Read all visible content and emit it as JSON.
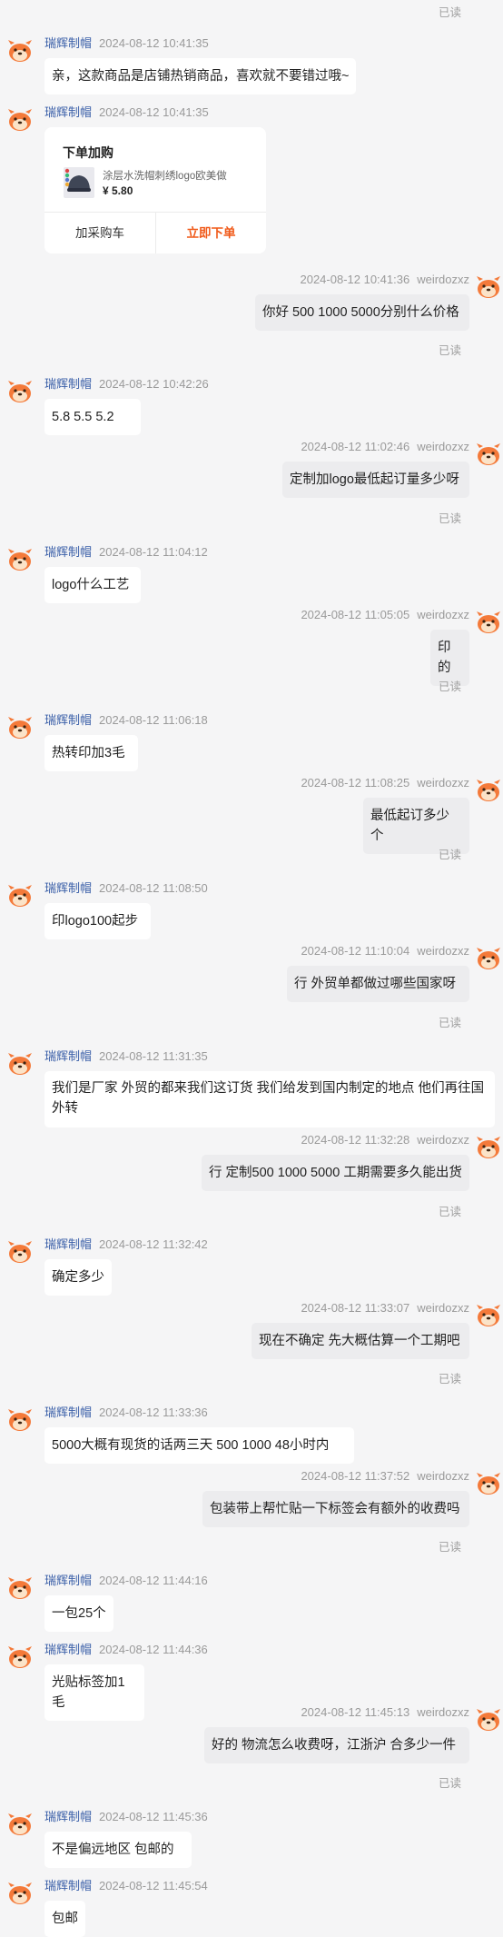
{
  "top_read": "已读",
  "colors": {
    "accent": "#f05a1a",
    "name": "#3a5fa8",
    "meta": "#9a9a9a"
  },
  "order_card": {
    "title": "下单加购",
    "product": "涂层水洗帽刺绣logo欧美做",
    "price": "¥ 5.80",
    "add_cart_label": "加采购车",
    "buy_now_label": "立即下单"
  },
  "messages": [
    {
      "side": "left",
      "name": "瑞辉制帽",
      "time": "2024-08-12 10:41:35",
      "text": "亲，这款商品是店铺热销商品，喜欢就不要错过哦~"
    },
    {
      "side": "left",
      "name": "瑞辉制帽",
      "time": "2024-08-12 10:41:35",
      "card": true
    },
    {
      "side": "right",
      "name": "weirdozxz",
      "time": "2024-08-12 10:41:36",
      "text": "你好 500 1000 5000分别什么价格",
      "read": "已读"
    },
    {
      "side": "left",
      "name": "瑞辉制帽",
      "time": "2024-08-12 10:42:26",
      "text": "5.8   5.5     5.2"
    },
    {
      "side": "right",
      "name": "weirdozxz",
      "time": "2024-08-12 11:02:46",
      "text": "定制加logo最低起订量多少呀",
      "read": "已读"
    },
    {
      "side": "left",
      "name": "瑞辉制帽",
      "time": "2024-08-12 11:04:12",
      "text": "logo什么工艺"
    },
    {
      "side": "right",
      "name": "weirdozxz",
      "time": "2024-08-12 11:05:05",
      "text": "印的",
      "read": "已读"
    },
    {
      "side": "left",
      "name": "瑞辉制帽",
      "time": "2024-08-12 11:06:18",
      "text": "热转印加3毛"
    },
    {
      "side": "right",
      "name": "weirdozxz",
      "time": "2024-08-12 11:08:25",
      "text": "最低起订多少个",
      "read": "已读"
    },
    {
      "side": "left",
      "name": "瑞辉制帽",
      "time": "2024-08-12 11:08:50",
      "text": "印logo100起步"
    },
    {
      "side": "right",
      "name": "weirdozxz",
      "time": "2024-08-12 11:10:04",
      "text": "行 外贸单都做过哪些国家呀",
      "read": "已读"
    },
    {
      "side": "left",
      "name": "瑞辉制帽",
      "time": "2024-08-12 11:31:35",
      "text": "我们是厂家   外贸的都来我们这订货 我们给发到国内制定的地点 他们再往国外转"
    },
    {
      "side": "right",
      "name": "weirdozxz",
      "time": "2024-08-12 11:32:28",
      "text": "行 定制500 1000 5000 工期需要多久能出货",
      "read": "已读"
    },
    {
      "side": "left",
      "name": "瑞辉制帽",
      "time": "2024-08-12 11:32:42",
      "text": "确定多少"
    },
    {
      "side": "right",
      "name": "weirdozxz",
      "time": "2024-08-12 11:33:07",
      "text": "现在不确定 先大概估算一个工期吧",
      "read": "已读"
    },
    {
      "side": "left",
      "name": "瑞辉制帽",
      "time": "2024-08-12 11:33:36",
      "text": "5000大概有现货的话两三天  500    1000    48小时内"
    },
    {
      "side": "right",
      "name": "weirdozxz",
      "time": "2024-08-12 11:37:52",
      "text": "包装带上帮忙贴一下标签会有额外的收费吗",
      "read": "已读"
    },
    {
      "side": "left",
      "name": "瑞辉制帽",
      "time": "2024-08-12 11:44:16",
      "text": "一包25个"
    },
    {
      "side": "left",
      "name": "瑞辉制帽",
      "time": "2024-08-12 11:44:36",
      "text": "光贴标签加1毛"
    },
    {
      "side": "right",
      "name": "weirdozxz",
      "time": "2024-08-12 11:45:13",
      "text": "好的  物流怎么收费呀，江浙沪 合多少一件",
      "read": "已读"
    },
    {
      "side": "left",
      "name": "瑞辉制帽",
      "time": "2024-08-12 11:45:36",
      "text": "不是偏远地区 包邮的"
    },
    {
      "side": "left",
      "name": "瑞辉制帽",
      "time": "2024-08-12 11:45:54",
      "text": "包邮"
    }
  ]
}
